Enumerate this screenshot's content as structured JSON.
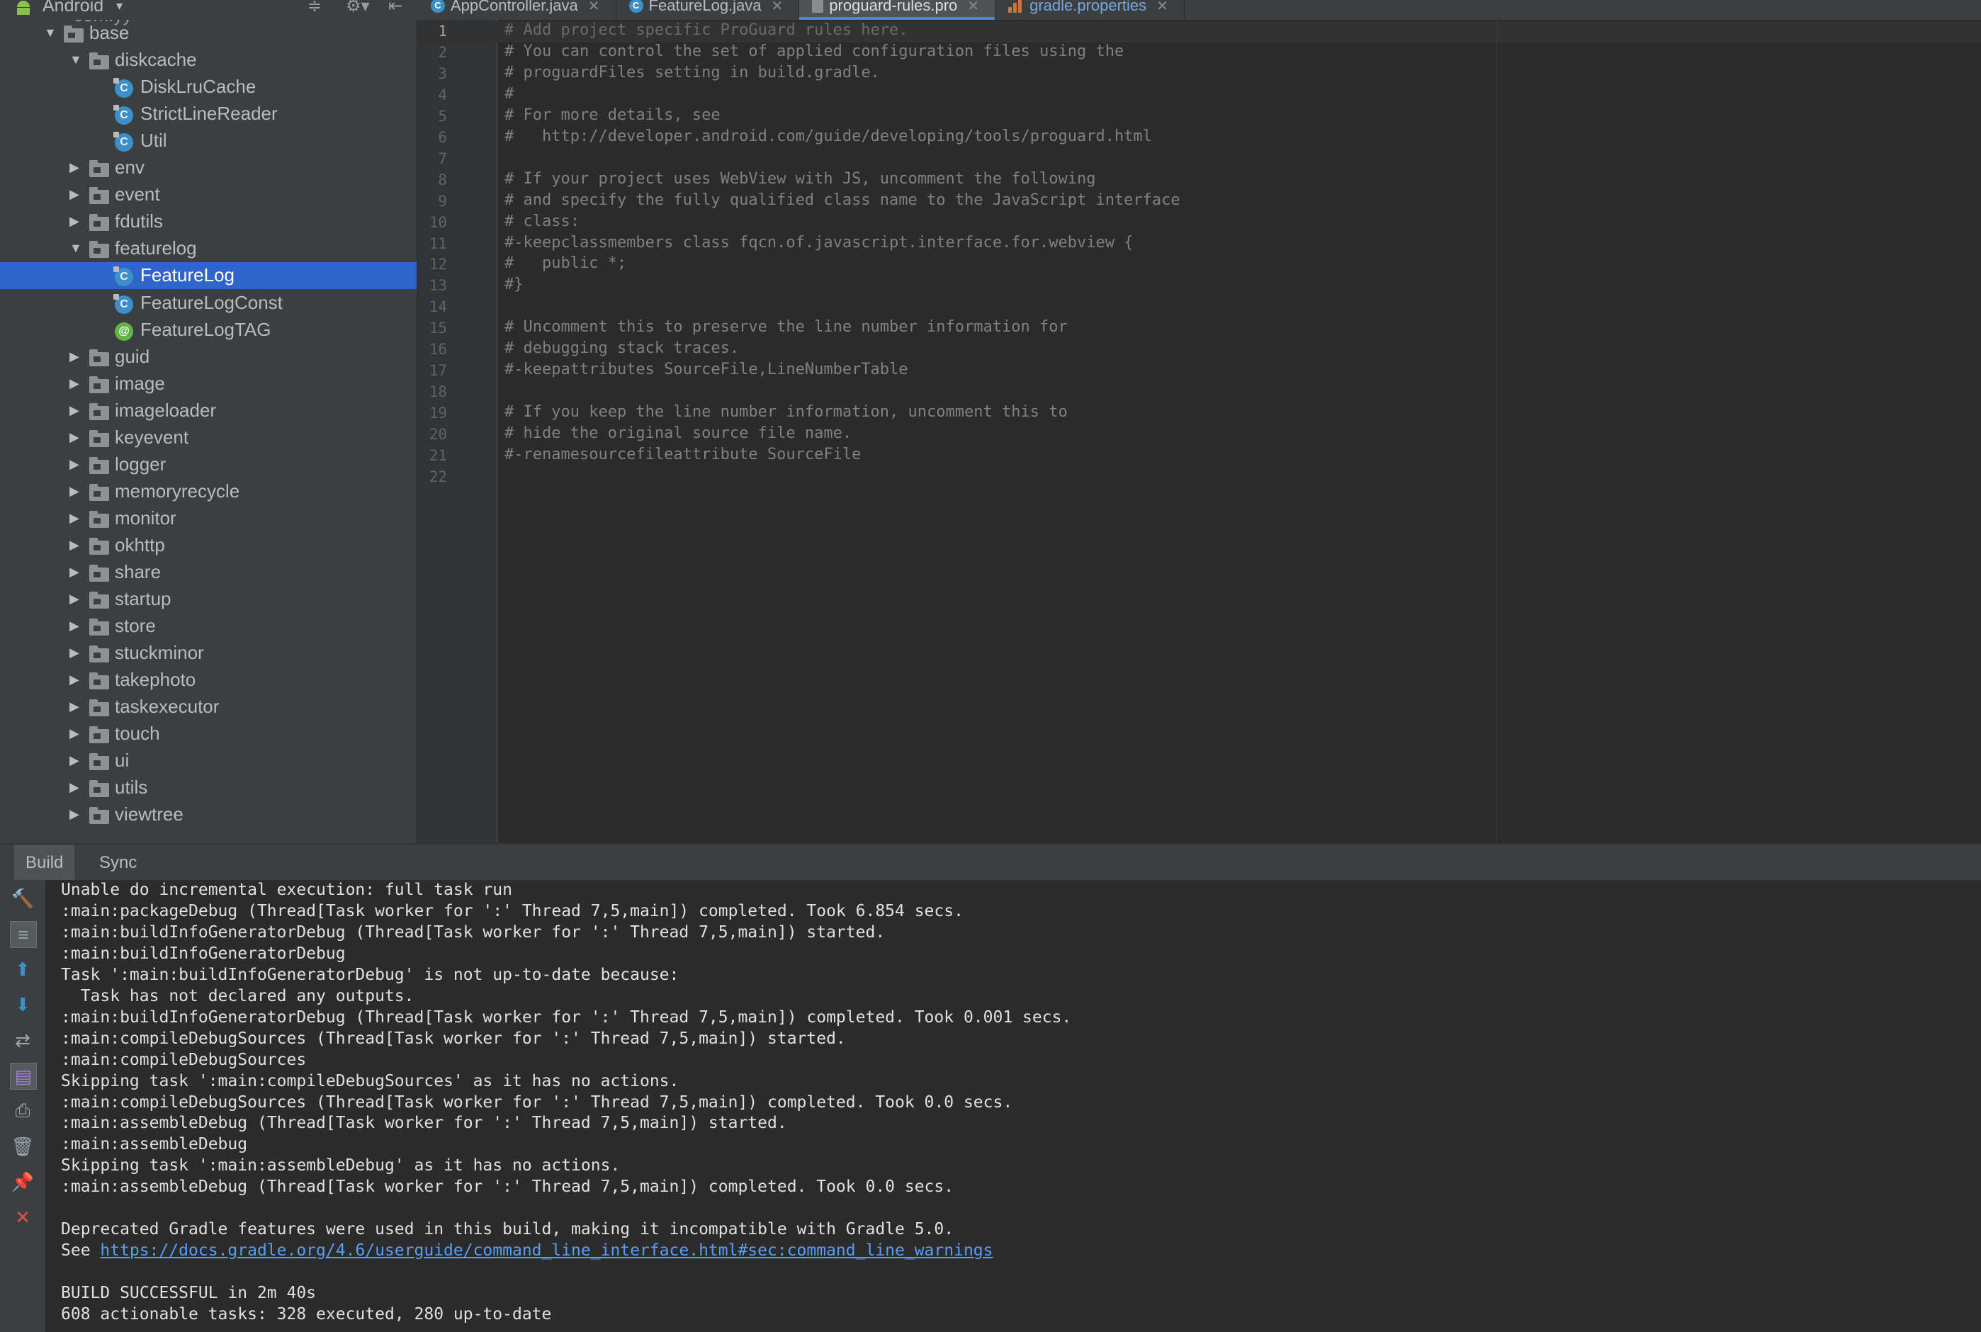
{
  "project_panel": {
    "title": "Android",
    "dropdown_glyph": "▾",
    "tool_glyphs": [
      "≑",
      "⚙▾",
      "⇤"
    ]
  },
  "editor_tabs": [
    {
      "label": "AppController.java",
      "icon": "class-icon",
      "active": false
    },
    {
      "label": "FeatureLog.java",
      "icon": "class-icon",
      "active": false
    },
    {
      "label": "proguard-rules.pro",
      "icon": "file-icon",
      "active": true
    },
    {
      "label": "gradle.properties",
      "icon": "gradle-icon",
      "active": false
    }
  ],
  "tree": {
    "partial_top": "com.yy",
    "rows": [
      {
        "label": "base",
        "type": "folder",
        "depth": 0,
        "expanded": true
      },
      {
        "label": "diskcache",
        "type": "folder",
        "depth": 1,
        "expanded": true
      },
      {
        "label": "DiskLruCache",
        "type": "class",
        "depth": 2
      },
      {
        "label": "StrictLineReader",
        "type": "class",
        "depth": 2
      },
      {
        "label": "Util",
        "type": "class",
        "depth": 2
      },
      {
        "label": "env",
        "type": "folder",
        "depth": 1,
        "expanded": false
      },
      {
        "label": "event",
        "type": "folder",
        "depth": 1,
        "expanded": false
      },
      {
        "label": "fdutils",
        "type": "folder",
        "depth": 1,
        "expanded": false
      },
      {
        "label": "featurelog",
        "type": "folder",
        "depth": 1,
        "expanded": true
      },
      {
        "label": "FeatureLog",
        "type": "class",
        "depth": 2,
        "selected": true
      },
      {
        "label": "FeatureLogConst",
        "type": "class",
        "depth": 2
      },
      {
        "label": "FeatureLogTAG",
        "type": "annotation",
        "depth": 2
      },
      {
        "label": "guid",
        "type": "folder",
        "depth": 1,
        "expanded": false
      },
      {
        "label": "image",
        "type": "folder",
        "depth": 1,
        "expanded": false
      },
      {
        "label": "imageloader",
        "type": "folder",
        "depth": 1,
        "expanded": false
      },
      {
        "label": "keyevent",
        "type": "folder",
        "depth": 1,
        "expanded": false
      },
      {
        "label": "logger",
        "type": "folder",
        "depth": 1,
        "expanded": false
      },
      {
        "label": "memoryrecycle",
        "type": "folder",
        "depth": 1,
        "expanded": false
      },
      {
        "label": "monitor",
        "type": "folder",
        "depth": 1,
        "expanded": false
      },
      {
        "label": "okhttp",
        "type": "folder",
        "depth": 1,
        "expanded": false
      },
      {
        "label": "share",
        "type": "folder",
        "depth": 1,
        "expanded": false
      },
      {
        "label": "startup",
        "type": "folder",
        "depth": 1,
        "expanded": false
      },
      {
        "label": "store",
        "type": "folder",
        "depth": 1,
        "expanded": false
      },
      {
        "label": "stuckminor",
        "type": "folder",
        "depth": 1,
        "expanded": false
      },
      {
        "label": "takephoto",
        "type": "folder",
        "depth": 1,
        "expanded": false
      },
      {
        "label": "taskexecutor",
        "type": "folder",
        "depth": 1,
        "expanded": false
      },
      {
        "label": "touch",
        "type": "folder",
        "depth": 1,
        "expanded": false
      },
      {
        "label": "ui",
        "type": "folder",
        "depth": 1,
        "expanded": false
      },
      {
        "label": "utils",
        "type": "folder",
        "depth": 1,
        "expanded": false
      },
      {
        "label": "viewtree",
        "type": "folder",
        "depth": 1,
        "expanded": false
      }
    ]
  },
  "editor": {
    "current_line": 1,
    "lines": [
      "# Add project specific ProGuard rules here.",
      "# You can control the set of applied configuration files using the",
      "# proguardFiles setting in build.gradle.",
      "#",
      "# For more details, see",
      "#   http://developer.android.com/guide/developing/tools/proguard.html",
      "",
      "# If your project uses WebView with JS, uncomment the following",
      "# and specify the fully qualified class name to the JavaScript interface",
      "# class:",
      "#-keepclassmembers class fqcn.of.javascript.interface.for.webview {",
      "#   public *;",
      "#}",
      "",
      "# Uncomment this to preserve the line number information for",
      "# debugging stack traces.",
      "#-keepattributes SourceFile,LineNumberTable",
      "",
      "# If you keep the line number information, uncomment this to",
      "# hide the original source file name.",
      "#-renamesourcefileattribute SourceFile",
      ""
    ]
  },
  "build_panel": {
    "tabs": [
      {
        "label": "Build",
        "active": true
      },
      {
        "label": "Sync",
        "active": false
      }
    ],
    "tools": [
      {
        "name": "hammer-icon",
        "glyph": "🔨",
        "color": "#62b543",
        "boxed": false
      },
      {
        "name": "toggle-view-icon",
        "glyph": "≡",
        "color": "#9aa7b0",
        "boxed": true
      },
      {
        "name": "arrow-up-icon",
        "glyph": "⬆",
        "color": "#3d8fc7",
        "boxed": false
      },
      {
        "name": "arrow-down-icon",
        "glyph": "⬇",
        "color": "#3d8fc7",
        "boxed": false
      },
      {
        "name": "soft-wrap-icon",
        "glyph": "⇄",
        "color": "#9aa7b0",
        "boxed": false
      },
      {
        "name": "scroll-to-end-icon",
        "glyph": "▤",
        "color": "#9a7fd1",
        "boxed": true
      },
      {
        "name": "print-icon",
        "glyph": "⎙",
        "color": "#9aa7b0",
        "boxed": false
      },
      {
        "name": "trash-icon",
        "glyph": "🗑",
        "color": "#9aa7b0",
        "boxed": false
      },
      {
        "name": "pin-icon",
        "glyph": "📌",
        "color": "#9a7fd1",
        "boxed": false
      },
      {
        "name": "close-icon",
        "glyph": "✕",
        "color": "#e0504a",
        "boxed": false
      }
    ],
    "lines": [
      {
        "text": "Unable do incremental execution: full task run"
      },
      {
        "text": ":main:packageDebug (Thread[Task worker for ':' Thread 7,5,main]) completed. Took 6.854 secs."
      },
      {
        "text": ":main:buildInfoGeneratorDebug (Thread[Task worker for ':' Thread 7,5,main]) started."
      },
      {
        "text": ":main:buildInfoGeneratorDebug"
      },
      {
        "text": "Task ':main:buildInfoGeneratorDebug' is not up-to-date because:"
      },
      {
        "text": "  Task has not declared any outputs."
      },
      {
        "text": ":main:buildInfoGeneratorDebug (Thread[Task worker for ':' Thread 7,5,main]) completed. Took 0.001 secs."
      },
      {
        "text": ":main:compileDebugSources (Thread[Task worker for ':' Thread 7,5,main]) started."
      },
      {
        "text": ":main:compileDebugSources"
      },
      {
        "text": "Skipping task ':main:compileDebugSources' as it has no actions."
      },
      {
        "text": ":main:compileDebugSources (Thread[Task worker for ':' Thread 7,5,main]) completed. Took 0.0 secs."
      },
      {
        "text": ":main:assembleDebug (Thread[Task worker for ':' Thread 7,5,main]) started."
      },
      {
        "text": ":main:assembleDebug"
      },
      {
        "text": "Skipping task ':main:assembleDebug' as it has no actions."
      },
      {
        "text": ":main:assembleDebug (Thread[Task worker for ':' Thread 7,5,main]) completed. Took 0.0 secs."
      },
      {
        "text": ""
      },
      {
        "text": "Deprecated Gradle features were used in this build, making it incompatible with Gradle 5.0."
      },
      {
        "text": "See ",
        "link": "https://docs.gradle.org/4.6/userguide/command_line_interface.html#sec:command_line_warnings"
      },
      {
        "text": ""
      },
      {
        "text": "BUILD SUCCESSFUL in 2m 40s"
      },
      {
        "text": "608 actionable tasks: 328 executed, 280 up-to-date"
      }
    ]
  }
}
